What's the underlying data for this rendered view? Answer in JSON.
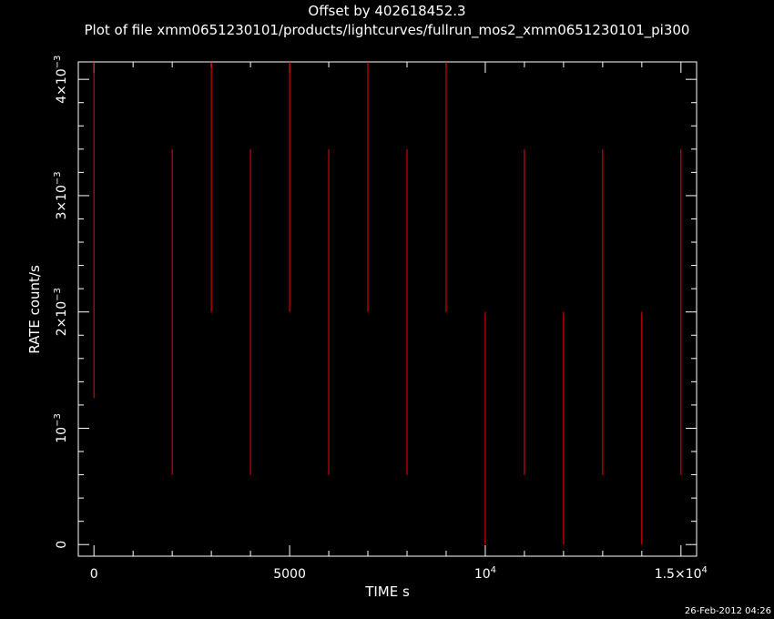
{
  "header": {
    "title": "Offset by 402618452.3",
    "subtitle": "Plot of file xmm0651230101/products/lightcurves/fullrun_mos2_xmm0651230101_pi300"
  },
  "footer": {
    "timestamp": "26-Feb-2012 04:26"
  },
  "colors": {
    "background": "#000000",
    "axes": "#ffffff",
    "data": "#ff0000"
  },
  "chart_data": {
    "type": "scatter",
    "title": "Offset by 402618452.3",
    "subtitle": "Plot of file xmm0651230101/products/lightcurves/fullrun_mos2_xmm0651230101_pi300",
    "xlabel": "TIME s",
    "ylabel": "RATE count/s",
    "xlim": [
      -400,
      15400
    ],
    "ylim": [
      -0.0001,
      0.00415
    ],
    "error_bars": "vertical",
    "grid": false,
    "legend": "none",
    "x_ticks": [
      {
        "value": 0,
        "label": "0"
      },
      {
        "value": 5000,
        "label": "5000"
      },
      {
        "value": 10000,
        "label": "10",
        "exp": "4"
      },
      {
        "value": 15000,
        "label": "1.5×10",
        "exp": "4"
      }
    ],
    "y_ticks": [
      {
        "value": 0,
        "label": "0"
      },
      {
        "value": 0.001,
        "label": "10",
        "exp": "−3"
      },
      {
        "value": 0.002,
        "label": "2×10",
        "exp": "−3"
      },
      {
        "value": 0.003,
        "label": "3×10",
        "exp": "−3"
      },
      {
        "value": 0.004,
        "label": "4×10",
        "exp": "−3"
      }
    ],
    "series": [
      {
        "x": [
          0,
          2000,
          3000,
          4000,
          5000,
          6000,
          7000,
          8000,
          9000,
          10000,
          11000,
          12000,
          13000,
          14000,
          15000
        ],
        "y_low": [
          0.00126,
          0.0006,
          0.002,
          0.0006,
          0.002,
          0.0006,
          0.002,
          0.0006,
          0.002,
          0.0,
          0.0006,
          0.0,
          0.0006,
          0.0,
          0.0006
        ],
        "y_high": [
          0.00415,
          0.0034,
          0.00415,
          0.0034,
          0.00415,
          0.0034,
          0.00415,
          0.0034,
          0.00415,
          0.002,
          0.0034,
          0.002,
          0.0034,
          0.002,
          0.0034
        ]
      }
    ]
  }
}
